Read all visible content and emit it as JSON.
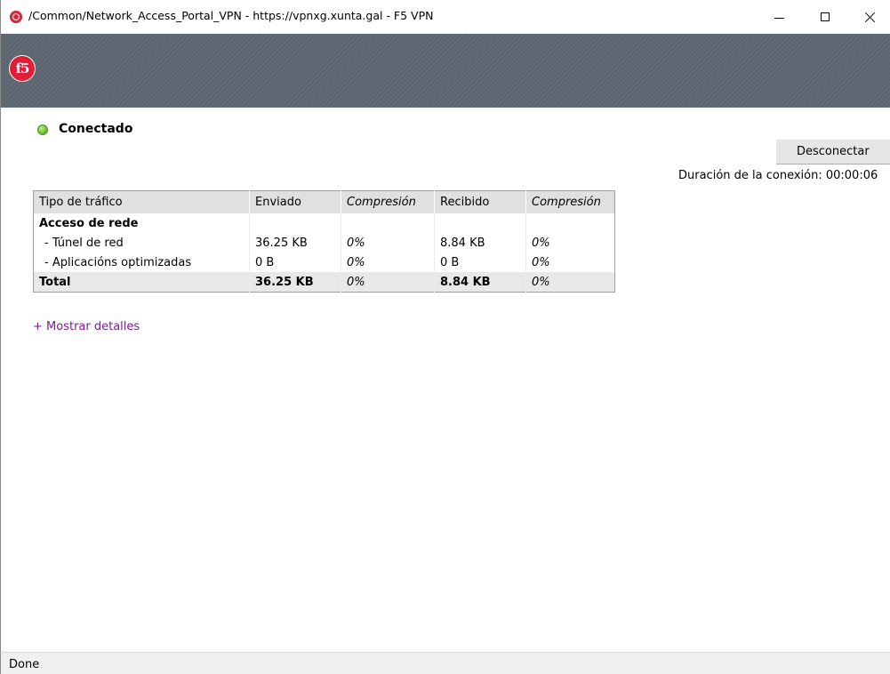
{
  "window": {
    "title": "/Common/Network_Access_Portal_VPN - https://vpnxg.xunta.gal - F5 VPN",
    "icon": "f5-vpn-icon"
  },
  "banner": {
    "logo_text": "f5",
    "logo_color": "#e21d38"
  },
  "status": {
    "label": "Conectado",
    "color": "#7fc93a"
  },
  "actions": {
    "disconnect_label": "Desconectar"
  },
  "connection": {
    "duration_text": "Duración de la conexión: 00:00:06"
  },
  "table": {
    "headers": [
      "Tipo de tráfico",
      "Enviado",
      "Compresión",
      "Recibido",
      "Compresión"
    ],
    "group_label": "Acceso de rede",
    "rows": [
      {
        "type": "- Túnel de red",
        "sent": "36.25 KB",
        "sent_compression": "0%",
        "received": "8.84 KB",
        "received_compression": "0%"
      },
      {
        "type": "- Aplicacións optimizadas",
        "sent": "0 B",
        "sent_compression": "0%",
        "received": "0 B",
        "received_compression": "0%"
      }
    ],
    "total": {
      "type": "Total",
      "sent": "36.25 KB",
      "sent_compression": "0%",
      "received": "8.84 KB",
      "received_compression": "0%"
    }
  },
  "links": {
    "show_details": "+ Mostrar detalles"
  },
  "statusbar": {
    "text": "Done"
  }
}
